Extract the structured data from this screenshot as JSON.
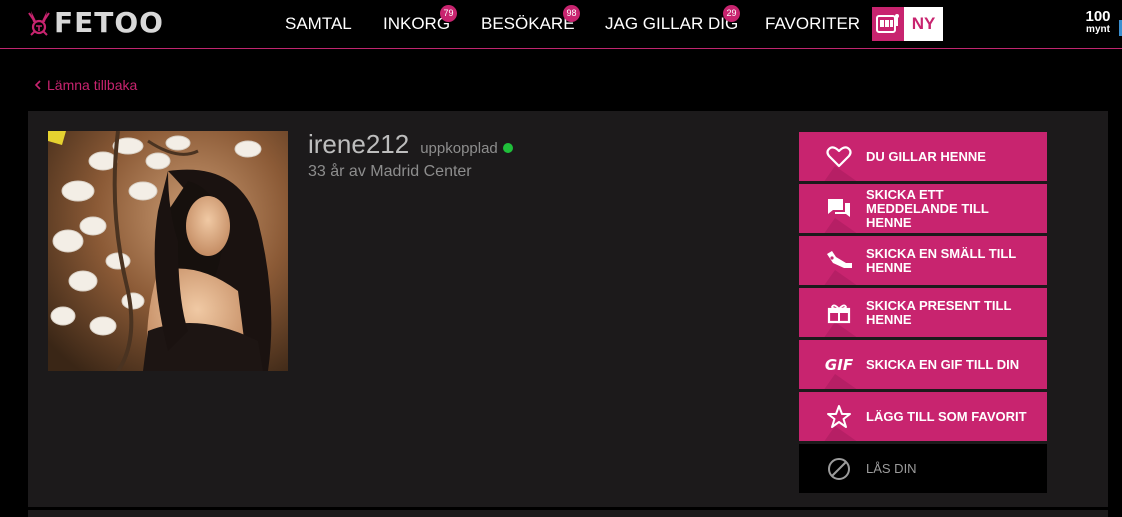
{
  "brand": {
    "name": "FETOO",
    "accent": "#c8246f"
  },
  "nav": {
    "items": [
      {
        "label": "SAMTAL",
        "badge": null
      },
      {
        "label": "INKORG",
        "badge": "79"
      },
      {
        "label": "BESÖKARE",
        "badge": "98"
      },
      {
        "label": "JAG GILLAR DIG",
        "badge": "29"
      },
      {
        "label": "FAVORITER",
        "badge": null
      }
    ],
    "new_label": "NY"
  },
  "coins": {
    "amount": "100",
    "unit": "mynt"
  },
  "back_label": "Lämna tillbaka",
  "profile": {
    "username": "irene212",
    "status": "uppkopplad",
    "info": "33 år av Madrid Center"
  },
  "actions": [
    {
      "icon": "heart-outline-icon",
      "label": "DU GILLAR HENNE"
    },
    {
      "icon": "chat-bubbles-icon",
      "label": "SKICKA ETT MEDDELANDE TILL HENNE"
    },
    {
      "icon": "bottle-icon",
      "label": "SKICKA EN SMÄLL TILL HENNE"
    },
    {
      "icon": "gift-icon",
      "label": "SKICKA PRESENT TILL HENNE"
    },
    {
      "icon": "gif-icon",
      "label": "SKICKA EN GIF TILL DIN",
      "icon_text": "GIF"
    },
    {
      "icon": "star-outline-icon",
      "label": "LÄGG TILL SOM FAVORIT"
    },
    {
      "icon": "block-icon",
      "label": "LÅS DIN"
    }
  ]
}
